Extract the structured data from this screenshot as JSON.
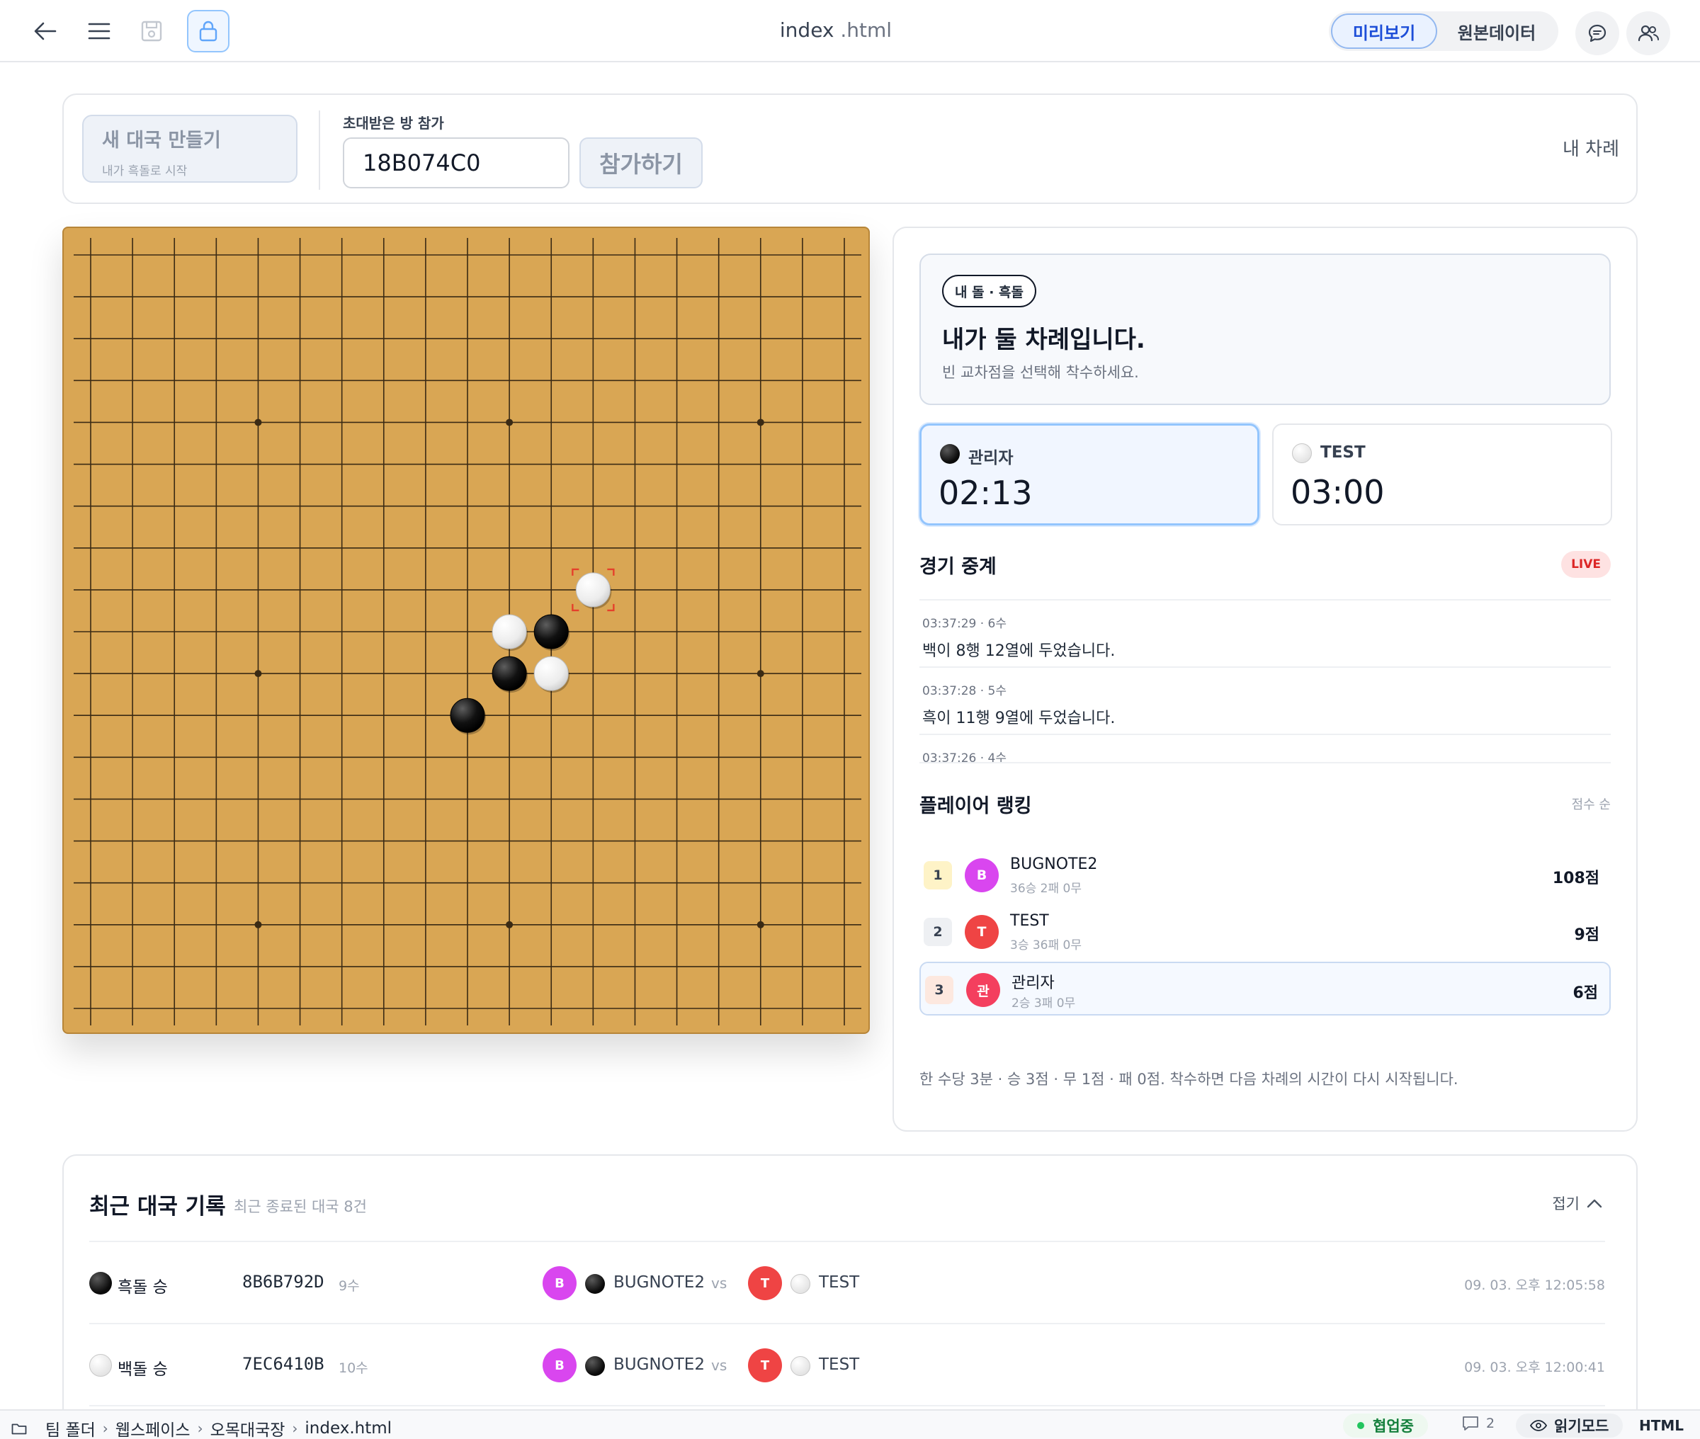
{
  "toolbar": {
    "filename": "index",
    "extension": ".html",
    "preview_label": "미리보기",
    "source_label": "원본데이터"
  },
  "controls": {
    "new_game_title": "새 대국 만들기",
    "new_game_sub": "내가 흑돌로 시작",
    "join_label": "초대받은 방 참가",
    "room_code": "18B074C0",
    "join_button": "참가하기",
    "turn_status": "내 차례"
  },
  "board": {
    "size": 19,
    "hoshi_labels": "star points",
    "stones": [
      {
        "color": "white",
        "row": 8,
        "col": 12,
        "last": true
      },
      {
        "color": "white",
        "row": 9,
        "col": 10
      },
      {
        "color": "black",
        "row": 9,
        "col": 11
      },
      {
        "color": "black",
        "row": 10,
        "col": 10
      },
      {
        "color": "white",
        "row": 10,
        "col": 11
      },
      {
        "color": "black",
        "row": 11,
        "col": 9
      }
    ]
  },
  "panel": {
    "my_stone_pill": "내 돌 · 흑돌",
    "turn_title": "내가 둘 차례입니다.",
    "turn_sub": "빈 교차점을 선택해 착수하세요.",
    "timers": [
      {
        "name": "관리자",
        "time": "02:13",
        "stone": "black"
      },
      {
        "name": "TEST",
        "time": "03:00",
        "stone": "white"
      }
    ],
    "live_title": "경기 중계",
    "live_badge": "LIVE",
    "feed": [
      {
        "ts": "03:37:29 · 6수",
        "msg": "백이 8행 12열에 두었습니다."
      },
      {
        "ts": "03:37:28 · 5수",
        "msg": "흑이 11행 9열에 두었습니다."
      },
      {
        "ts": "03:37:26 · 4수",
        "msg": ""
      }
    ],
    "ranking_title": "플레이어 랭킹",
    "ranking_sort": "점수 순",
    "ranking": [
      {
        "rank": "1",
        "initial": "B",
        "name": "BUGNOTE2",
        "record": "36승 2패 0무",
        "score": "108점",
        "color": "#d946ef",
        "rank_bg": "#fef3c7"
      },
      {
        "rank": "2",
        "initial": "T",
        "name": "TEST",
        "record": "3승 36패 0무",
        "score": "9점",
        "color": "#ef4444",
        "rank_bg": "#eef0f3"
      },
      {
        "rank": "3",
        "initial": "관",
        "name": "관리자",
        "record": "2승 3패 0무",
        "score": "6점",
        "color": "#f43f5e",
        "rank_bg": "#fde8df"
      }
    ],
    "rules": "한 수당 3분 · 승 3점 · 무 1점 · 패 0점. 착수하면 다음 차례의 시간이 다시 시작됩니다."
  },
  "history": {
    "title": "최근 대국 기록",
    "subtitle": "최근 종료된 대국 8건",
    "fold_label": "접기",
    "vs_label": "vs",
    "rows": [
      {
        "result": "흑돌 승",
        "winner": "black",
        "game_id": "8B6B792D",
        "moves": "9수",
        "p1_initial": "B",
        "p1": "BUGNOTE2",
        "p2_initial": "T",
        "p2": "TEST",
        "date": "09. 03. 오후 12:05:58"
      },
      {
        "result": "백돌 승",
        "winner": "white",
        "game_id": "7EC6410B",
        "moves": "10수",
        "p1_initial": "B",
        "p1": "BUGNOTE2",
        "p2_initial": "T",
        "p2": "TEST",
        "date": "09. 03. 오후 12:00:41"
      }
    ]
  },
  "statusbar": {
    "crumbs": [
      "팀 폴더",
      "웹스페이스",
      "오목대국장",
      "index.html"
    ],
    "collab": "협업중",
    "comments": "2",
    "readmode": "읽기모드",
    "filetype": "HTML"
  }
}
